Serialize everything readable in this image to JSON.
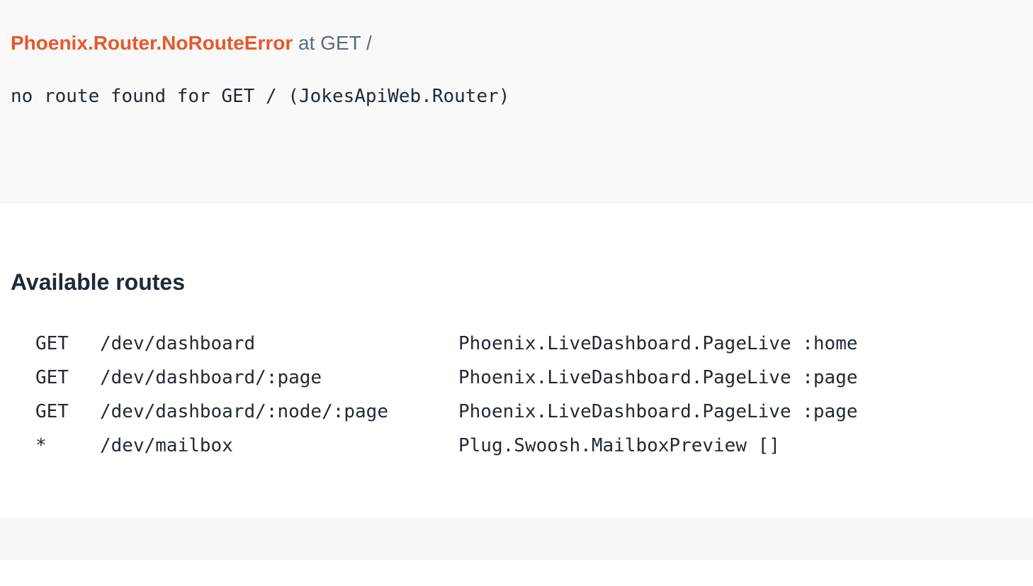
{
  "error": {
    "type": "Phoenix.Router.NoRouteError",
    "at": "at GET /",
    "message": "no route found for GET / (JokesApiWeb.Router)"
  },
  "routes_section": {
    "title": "Available routes",
    "routes": [
      {
        "method": "GET",
        "path": "/dev/dashboard",
        "handler": "Phoenix.LiveDashboard.PageLive :home"
      },
      {
        "method": "GET",
        "path": "/dev/dashboard/:page",
        "handler": "Phoenix.LiveDashboard.PageLive :page"
      },
      {
        "method": "GET",
        "path": "/dev/dashboard/:node/:page",
        "handler": "Phoenix.LiveDashboard.PageLive :page"
      },
      {
        "method": "*",
        "path": "/dev/mailbox",
        "handler": "Plug.Swoosh.MailboxPreview []"
      }
    ]
  },
  "colors": {
    "error_type": "#e9572b",
    "muted": "#5f6b7a",
    "text": "#222a35",
    "band": "#f9f9fa"
  }
}
